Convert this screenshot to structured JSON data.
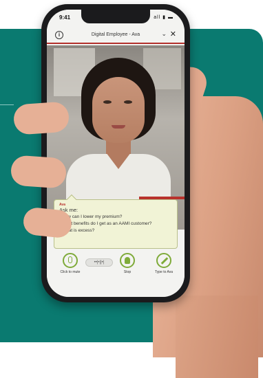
{
  "status": {
    "time": "9:41",
    "icons": "all ▮ ▬"
  },
  "header": {
    "title": "Digital Employee - Ava",
    "info": "i",
    "collapse": "⌄",
    "close": "✕"
  },
  "chat": {
    "sender": "Ava",
    "lines": [
      "Ask me:",
      "- How can I lower my premium?",
      "- What benefits do I get as an AAMI customer?",
      "- What is excess?"
    ]
  },
  "controls": {
    "mute_label": "Click to mute",
    "waveform": "••|•||•|",
    "stop_label": "Stop",
    "type_label": "Type to Ava"
  },
  "colors": {
    "teal": "#0a7a70",
    "accent_red": "#b22e2a",
    "green": "#7fab3a"
  }
}
